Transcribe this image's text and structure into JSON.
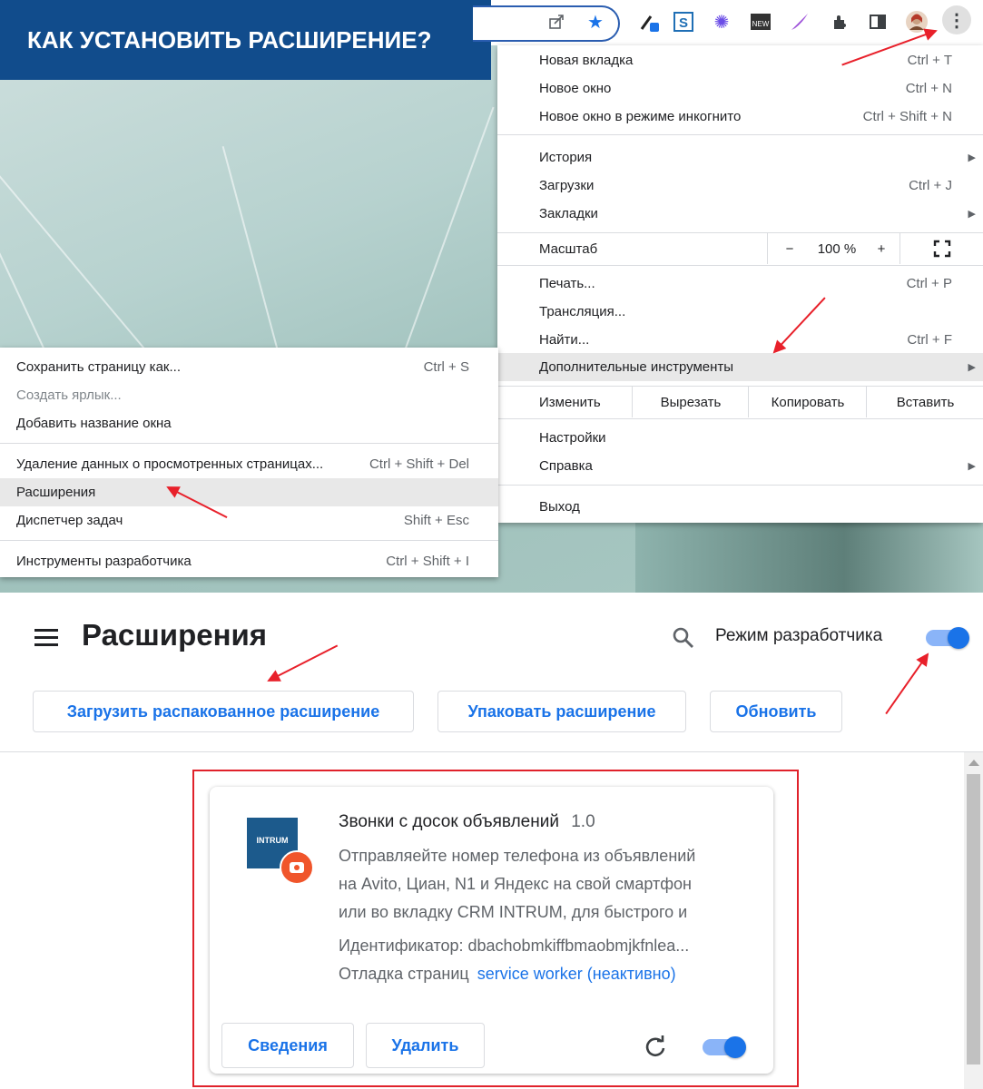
{
  "banner": {
    "title": "КАК УСТАНОВИТЬ РАСШИРЕНИЕ?"
  },
  "toolbar": {
    "icons": [
      "share-icon",
      "bookmark-star-icon",
      "pen-extension-icon",
      "s-extension-icon",
      "flower-extension-icon",
      "new-extension-icon",
      "feather-extension-icon",
      "puzzle-icon",
      "side-panel-icon",
      "profile-avatar",
      "more-vert-icon"
    ],
    "new_badge": "NEW"
  },
  "main_menu": {
    "items": [
      {
        "label": "Новая вкладка",
        "shortcut": "Ctrl + T"
      },
      {
        "label": "Новое окно",
        "shortcut": "Ctrl + N"
      },
      {
        "label": "Новое окно в режиме инкогнито",
        "shortcut": "Ctrl + Shift + N"
      },
      {
        "label": "История",
        "shortcut": ""
      },
      {
        "label": "Загрузки",
        "shortcut": "Ctrl + J"
      },
      {
        "label": "Закладки",
        "shortcut": ""
      },
      {
        "label": "Печать...",
        "shortcut": "Ctrl + P"
      },
      {
        "label": "Трансляция...",
        "shortcut": ""
      },
      {
        "label": "Найти...",
        "shortcut": "Ctrl + F"
      },
      {
        "label": "Дополнительные инструменты",
        "shortcut": ""
      },
      {
        "label": "Настройки",
        "shortcut": ""
      },
      {
        "label": "Справка",
        "shortcut": ""
      },
      {
        "label": "Выход",
        "shortcut": ""
      }
    ],
    "zoom": {
      "label": "Масштаб",
      "minus": "−",
      "value": "100 %",
      "plus": "+"
    },
    "edit": {
      "label": "Изменить",
      "cut": "Вырезать",
      "copy": "Копировать",
      "paste": "Вставить"
    }
  },
  "submenu": {
    "items": [
      {
        "label": "Сохранить страницу как...",
        "shortcut": "Ctrl + S"
      },
      {
        "label": "Создать ярлык...",
        "shortcut": ""
      },
      {
        "label": "Добавить название окна",
        "shortcut": ""
      },
      {
        "label": "Удаление данных о просмотренных страницах...",
        "shortcut": "Ctrl + Shift + Del"
      },
      {
        "label": "Расширения",
        "shortcut": ""
      },
      {
        "label": "Диспетчер задач",
        "shortcut": "Shift + Esc"
      },
      {
        "label": "Инструменты разработчика",
        "shortcut": "Ctrl + Shift + I"
      }
    ]
  },
  "extensions_page": {
    "title": "Расширения",
    "dev_mode_label": "Режим разработчика",
    "dev_mode_on": true,
    "buttons": {
      "load": "Загрузить распакованное расширение",
      "pack": "Упаковать расширение",
      "update": "Обновить"
    }
  },
  "extension_card": {
    "name": "Звонки с досок объявлений",
    "version": "1.0",
    "description_lines": [
      "Отправляейте номер телефона из объявлений",
      "на Avito, Циан, N1 и Яндекс на свой смартфон",
      "или во вкладку CRM INTRUM, для быстрого и"
    ],
    "id_line": "Идентификатор: dbachobmkiffbmaobmjkfnlea...",
    "debug_label": "Отладка страниц",
    "debug_link": "service worker (неактивно)",
    "logo_text": "INTRUM",
    "details_button": "Сведения",
    "remove_button": "Удалить",
    "enabled": true
  },
  "colors": {
    "banner": "#114c8c",
    "accent": "#1a73e8",
    "arrow": "#e8202a",
    "card_border": "#e0222b"
  }
}
